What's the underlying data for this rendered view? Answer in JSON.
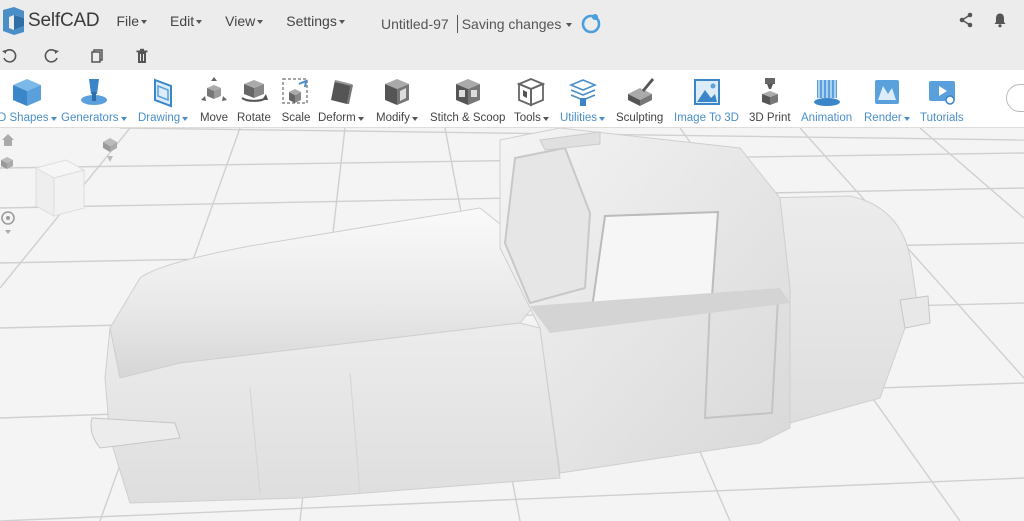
{
  "app": {
    "name": "SelfCAD",
    "brand_color": "#4a8ec8"
  },
  "menu": [
    {
      "label": "File"
    },
    {
      "label": "Edit"
    },
    {
      "label": "View"
    },
    {
      "label": "Settings"
    }
  ],
  "document": {
    "title": "Untitled-97",
    "status": "Saving changes"
  },
  "tools": [
    {
      "label": "D Shapes",
      "icon": "cube-icon",
      "dropdown": true,
      "accent": true
    },
    {
      "label": "Generators",
      "icon": "generator-icon",
      "dropdown": true,
      "accent": true
    },
    {
      "label": "Drawing",
      "icon": "drawing-icon",
      "dropdown": true,
      "accent": true
    },
    {
      "label": "Move",
      "icon": "move-icon",
      "dropdown": false,
      "accent": false
    },
    {
      "label": "Rotate",
      "icon": "rotate-icon",
      "dropdown": false,
      "accent": false
    },
    {
      "label": "Scale",
      "icon": "scale-icon",
      "dropdown": false,
      "accent": false
    },
    {
      "label": "Deform",
      "icon": "deform-icon",
      "dropdown": true,
      "accent": false
    },
    {
      "label": "Modify",
      "icon": "modify-icon",
      "dropdown": true,
      "accent": false
    },
    {
      "label": "Stitch & Scoop",
      "icon": "stitch-scoop-icon",
      "dropdown": false,
      "accent": false
    },
    {
      "label": "Tools",
      "icon": "tools-icon",
      "dropdown": true,
      "accent": false
    },
    {
      "label": "Utilities",
      "icon": "utilities-icon",
      "dropdown": true,
      "accent": true
    },
    {
      "label": "Sculpting",
      "icon": "sculpting-icon",
      "dropdown": false,
      "accent": false
    },
    {
      "label": "Image To 3D",
      "icon": "image-to-3d-icon",
      "dropdown": false,
      "accent": true
    },
    {
      "label": "3D Print",
      "icon": "3d-print-icon",
      "dropdown": false,
      "accent": false
    },
    {
      "label": "Animation",
      "icon": "animation-icon",
      "dropdown": false,
      "accent": true
    },
    {
      "label": "Render",
      "icon": "render-icon",
      "dropdown": true,
      "accent": true
    },
    {
      "label": "Tutorials",
      "icon": "tutorials-icon",
      "dropdown": false,
      "accent": true
    }
  ],
  "colors": {
    "menubar_bg": "#ececec",
    "toolbar_bg": "#ffffff",
    "viewport_bg": "#f4f4f4",
    "model": "#e6e6e6"
  }
}
